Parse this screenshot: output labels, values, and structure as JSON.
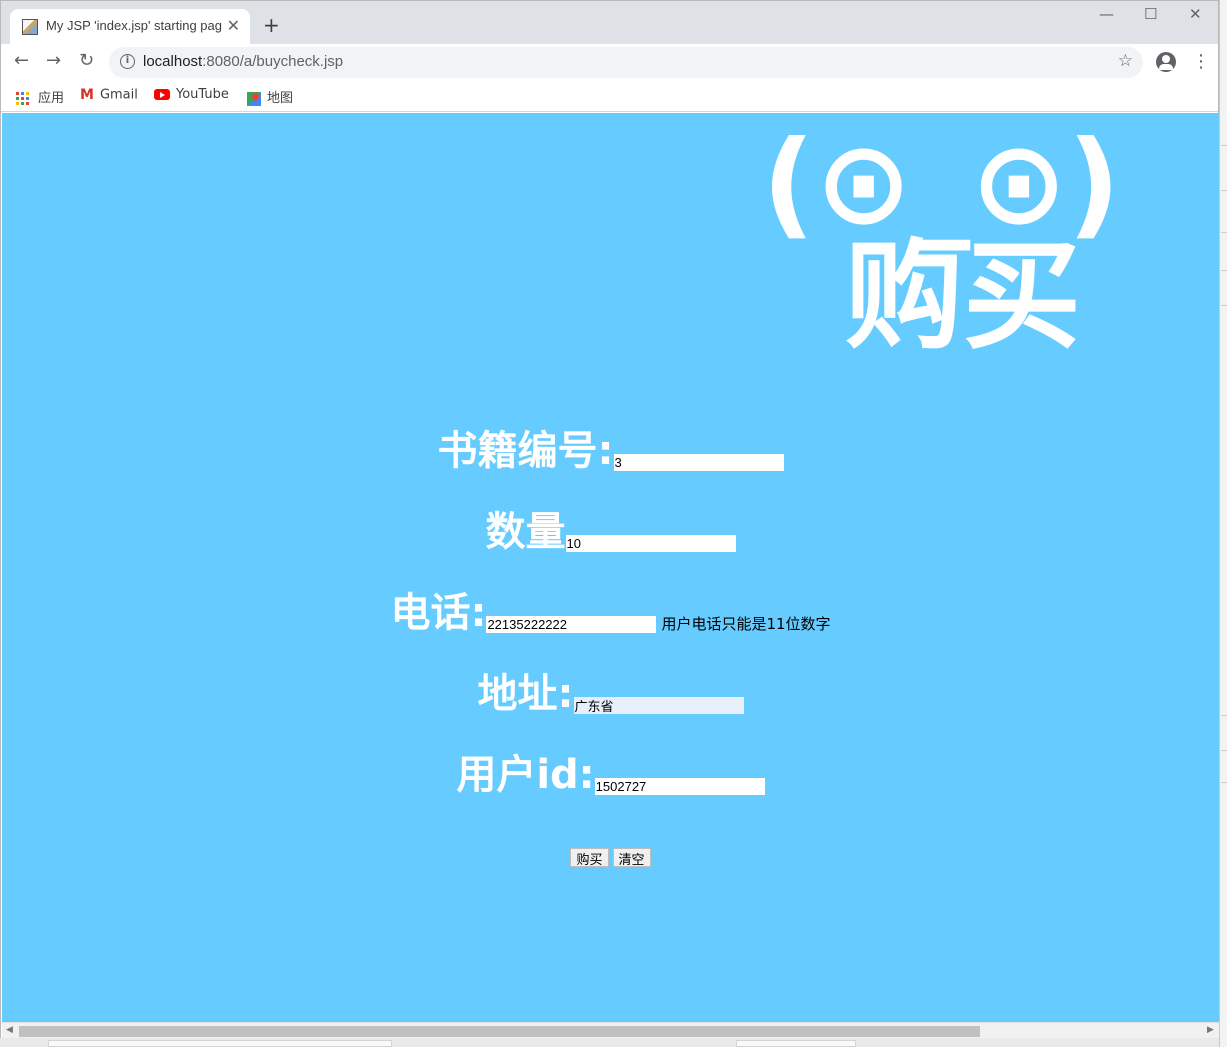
{
  "browser": {
    "tab_title": "My JSP 'index.jsp' starting page",
    "close_glyph": "✕",
    "newtab_glyph": "+",
    "window_controls": {
      "minimize": "—",
      "maximize": "☐",
      "close": "✕"
    },
    "nav": {
      "back": "←",
      "forward": "→",
      "reload": "↻"
    },
    "url": {
      "host": "localhost",
      "path": ":8080/a/buycheck.jsp"
    },
    "star_glyph": "☆",
    "menu_glyph": "⋮",
    "bookmarks": [
      {
        "label": "应用",
        "icon": "apps-grid-icon"
      },
      {
        "label": "Gmail",
        "icon": "gmail-icon"
      },
      {
        "label": "YouTube",
        "icon": "youtube-icon"
      },
      {
        "label": "地图",
        "icon": "maps-icon"
      }
    ]
  },
  "page": {
    "emoticon": "(⊙_⊙)",
    "title": "购买",
    "fields": [
      {
        "label": "书籍编号:",
        "value": "3"
      },
      {
        "label": "数量",
        "value": "10"
      },
      {
        "label": "电话:",
        "value": "22135222222",
        "hint": "用户电话只能是11位数字"
      },
      {
        "label": "地址:",
        "value": "广东省"
      },
      {
        "label": "用户id:",
        "value": "1502727"
      }
    ],
    "buttons": {
      "submit": "购买",
      "reset": "清空"
    }
  },
  "colors": {
    "page_background": "#66ccff",
    "heading_text": "#ffffff",
    "autofill_tint": "#e8f0fe"
  }
}
